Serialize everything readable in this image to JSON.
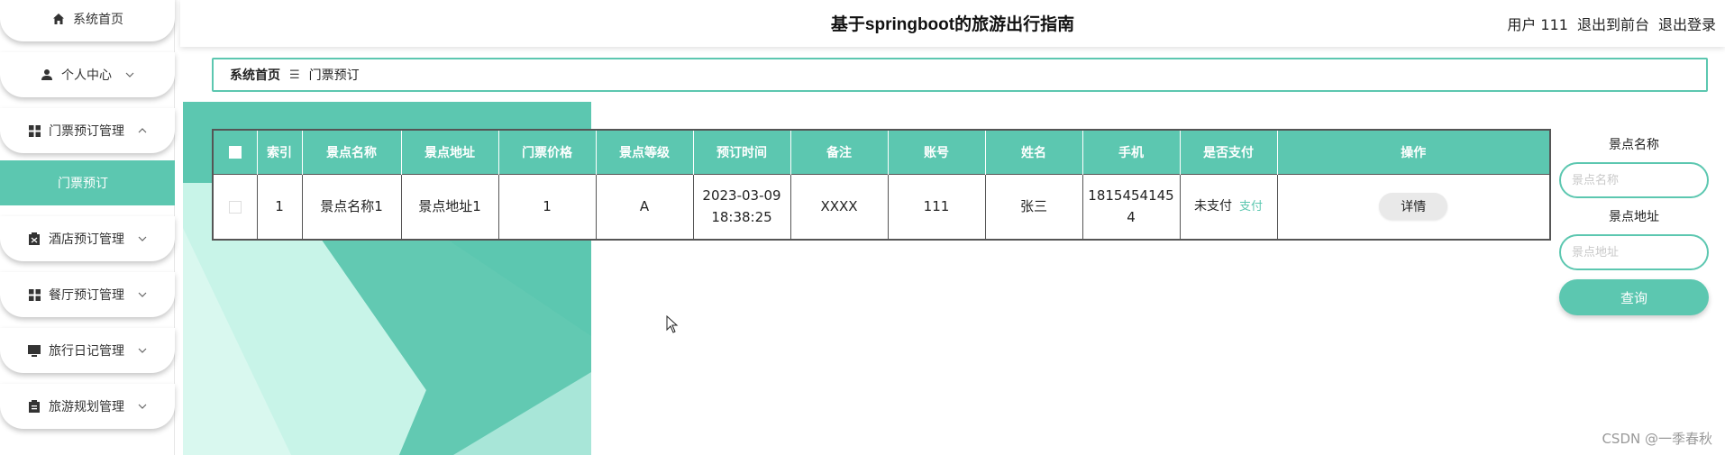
{
  "header": {
    "title": "基于springboot的旅游出行指南",
    "user": "用户 111",
    "to_front": "退出到前台",
    "logout": "退出登录"
  },
  "sidebar": {
    "items": [
      {
        "label": "系统首页",
        "icon": "home-icon"
      },
      {
        "label": "个人中心",
        "icon": "user-icon"
      },
      {
        "label": "门票预订管理",
        "icon": "grid-icon"
      },
      {
        "label": "酒店预订管理",
        "icon": "clipboard-icon"
      },
      {
        "label": "餐厅预订管理",
        "icon": "grid-icon"
      },
      {
        "label": "旅行日记管理",
        "icon": "monitor-icon"
      },
      {
        "label": "旅游规划管理",
        "icon": "clipboard-icon"
      }
    ],
    "active_sub": "门票预订"
  },
  "breadcrumb": {
    "home": "系统首页",
    "current": "门票预订"
  },
  "table": {
    "headers": [
      "索引",
      "景点名称",
      "景点地址",
      "门票价格",
      "景点等级",
      "预订时间",
      "备注",
      "账号",
      "姓名",
      "手机",
      "是否支付",
      "操作"
    ],
    "rows": [
      {
        "index": "1",
        "name": "景点名称1",
        "address": "景点地址1",
        "price": "1",
        "level": "A",
        "time_date": "2023-03-09",
        "time_clock": "18:38:25",
        "remark": "XXXX",
        "account": "111",
        "person": "张三",
        "phone_a": "1815454145",
        "phone_b": "4",
        "paid": "未支付",
        "pay_action": "支付",
        "detail": "详情"
      }
    ]
  },
  "search": {
    "name_label": "景点名称",
    "name_placeholder": "景点名称",
    "address_label": "景点地址",
    "address_placeholder": "景点地址",
    "button": "查询"
  },
  "watermark": "CSDN @一季春秋",
  "colors": {
    "accent": "#5cc7b0",
    "accent_light": "#c8f4e8"
  }
}
